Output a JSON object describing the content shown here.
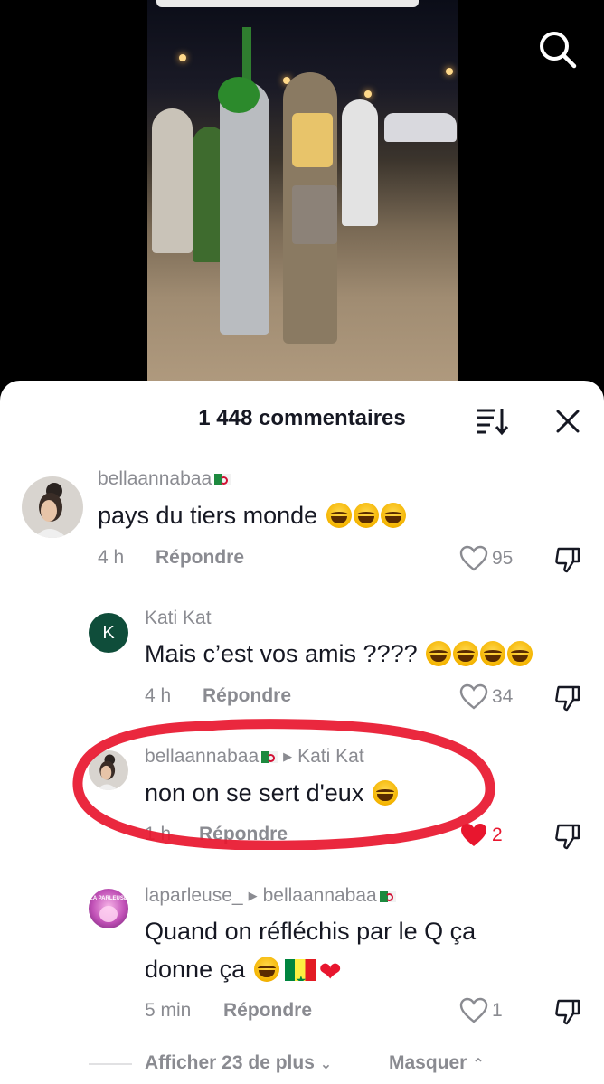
{
  "header": {
    "comment_count": "1 448 commentaires",
    "sort_icon": "sort-icon",
    "close_icon": "close-icon",
    "search_icon": "search-icon"
  },
  "comments": [
    {
      "user": "bellaannabaa",
      "user_flag": "algeria-flag-emoji",
      "text": "pays du tiers monde",
      "emojis": [
        "tears-of-joy",
        "tears-of-joy",
        "tears-of-joy"
      ],
      "time": "4 h",
      "reply_label": "Répondre",
      "likes": "95",
      "liked": false
    },
    {
      "user": "Kati Kat",
      "avatar_letter": "K",
      "text": "Mais c’est vos amis ????",
      "emojis": [
        "tears-of-joy",
        "tears-of-joy",
        "tears-of-joy",
        "tears-of-joy"
      ],
      "time": "4 h",
      "reply_label": "Répondre",
      "likes": "34",
      "liked": false
    },
    {
      "user": "bellaannabaa",
      "user_flag": "algeria-flag-emoji",
      "reply_to": "Kati Kat",
      "text": "non on se sert d'eux",
      "emojis": [
        "tears-of-joy"
      ],
      "time": "1 h",
      "reply_label": "Répondre",
      "likes": "2",
      "liked": true
    },
    {
      "user": "laparleuse_",
      "avatar_text": "LA PARLEUSE",
      "reply_to": "bellaannabaa",
      "reply_to_flag": "algeria-flag-emoji",
      "text_line1": "Quand on réfléchis par le Q ça",
      "text_line2": "donne ça",
      "emojis": [
        "tears-of-joy",
        "senegal-flag-emoji",
        "red-heart-emoji"
      ],
      "time": "5 min",
      "reply_label": "Répondre",
      "likes": "1",
      "liked": false
    }
  ],
  "footer": {
    "show_more": "Afficher 23 de plus",
    "hide": "Masquer"
  },
  "colors": {
    "highlight_ring": "#e8162e",
    "liked_heart": "#e8162e",
    "text_primary": "#161823",
    "text_secondary": "#8a8b91"
  }
}
